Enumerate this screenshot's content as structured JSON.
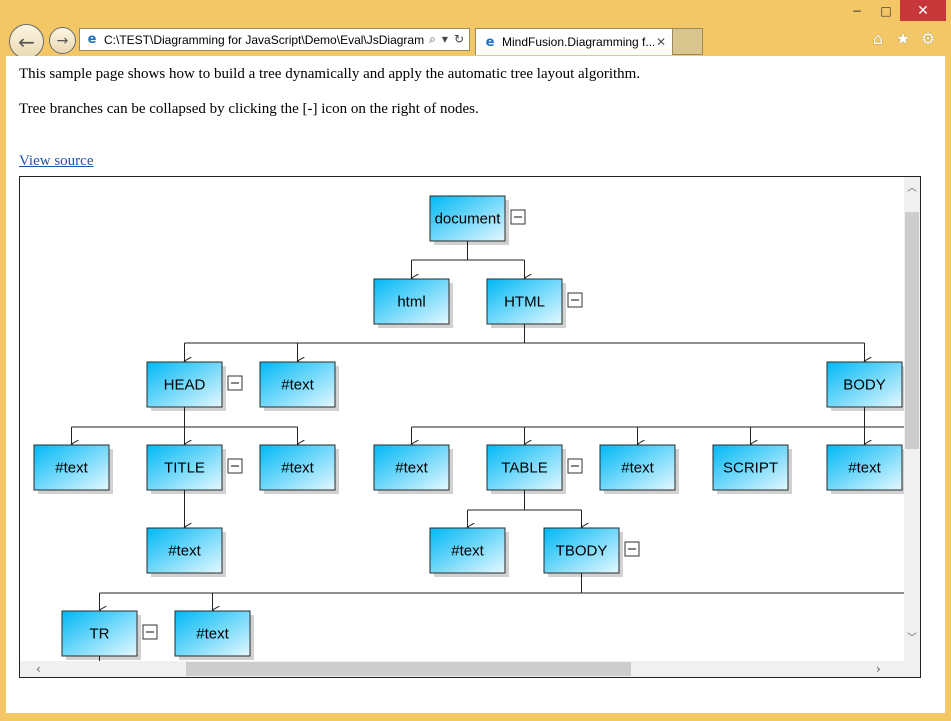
{
  "browser": {
    "address": "C:\\TEST\\Diagramming for JavaScript\\Demo\\Eval\\JsDiagram",
    "tab_title": "MindFusion.Diagramming f...",
    "window_controls": {
      "minimize": "−",
      "maximize": "□",
      "close": "✕"
    },
    "icons": [
      "back-arrow-icon",
      "forward-arrow-icon",
      "ie-page-icon",
      "search-icon",
      "dropdown-icon",
      "refresh-icon",
      "close-icon",
      "home-icon",
      "star-icon",
      "gear-icon"
    ]
  },
  "page": {
    "intro": "This sample page shows how to build a tree dynamically and apply the automatic tree layout algorithm.",
    "collapse_note": "Tree branches can be collapsed by clicking the [-] icon on the right of nodes.",
    "view_source": "View source"
  },
  "diagram": {
    "colors": {
      "node_top": "#00b8f5",
      "node_bottom": "#e4f8ff",
      "border": "#2a2a2a",
      "link": "#222222"
    },
    "collapse_symbol": "−",
    "nodes": [
      {
        "id": "document",
        "label": "document",
        "collapsible": true,
        "children": [
          "html",
          "HTML"
        ]
      },
      {
        "id": "html",
        "label": "html",
        "collapsible": false
      },
      {
        "id": "HTML",
        "label": "HTML",
        "collapsible": true,
        "children": [
          "HEAD",
          "text1",
          "BODY"
        ]
      },
      {
        "id": "HEAD",
        "label": "HEAD",
        "collapsible": true,
        "children": [
          "text2",
          "TITLE",
          "text3"
        ]
      },
      {
        "id": "text1",
        "label": "#text",
        "collapsible": false
      },
      {
        "id": "BODY",
        "label": "BODY",
        "collapsible": false,
        "children": [
          "text4",
          "TABLE",
          "text5",
          "SCRIPT",
          "text6"
        ]
      },
      {
        "id": "text2",
        "label": "#text",
        "collapsible": false
      },
      {
        "id": "TITLE",
        "label": "TITLE",
        "collapsible": true,
        "children": [
          "text7"
        ]
      },
      {
        "id": "text3",
        "label": "#text",
        "collapsible": false
      },
      {
        "id": "text4",
        "label": "#text",
        "collapsible": false
      },
      {
        "id": "TABLE",
        "label": "TABLE",
        "collapsible": true,
        "children": [
          "text8",
          "TBODY"
        ]
      },
      {
        "id": "text5",
        "label": "#text",
        "collapsible": false
      },
      {
        "id": "SCRIPT",
        "label": "SCRIPT",
        "collapsible": false
      },
      {
        "id": "text6",
        "label": "#text",
        "collapsible": false
      },
      {
        "id": "text7",
        "label": "#text",
        "collapsible": false
      },
      {
        "id": "text8",
        "label": "#text",
        "collapsible": false
      },
      {
        "id": "TBODY",
        "label": "TBODY",
        "collapsible": true,
        "children": [
          "TR",
          "text9"
        ]
      },
      {
        "id": "TR",
        "label": "TR",
        "collapsible": true
      },
      {
        "id": "text9",
        "label": "#text",
        "collapsible": false
      }
    ]
  }
}
